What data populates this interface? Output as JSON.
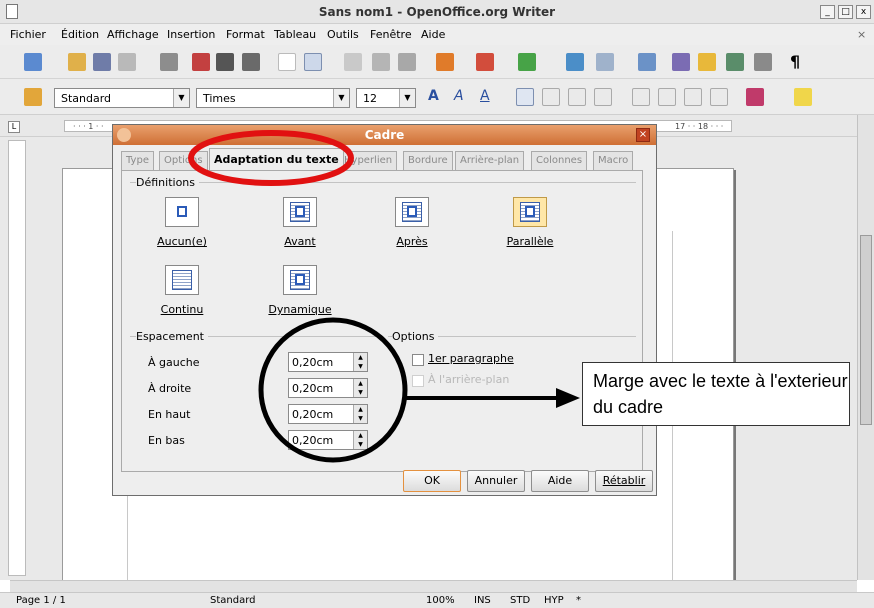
{
  "window": {
    "title": "Sans nom1 - OpenOffice.org Writer",
    "buttons": [
      "_",
      "□",
      "x"
    ],
    "close_doc": "×"
  },
  "menu": [
    "Fichier",
    "Édition",
    "Affichage",
    "Insertion",
    "Format",
    "Tableau",
    "Outils",
    "Fenêtre",
    "Aide"
  ],
  "formatting": {
    "style": "Standard",
    "font": "Times",
    "size": "12"
  },
  "ruler": {
    "marks": "· · · 1 · ·",
    "right": "17 · · 18 · · ·"
  },
  "dialog": {
    "title": "Cadre",
    "tabs": [
      "Type",
      "Options",
      "Adaptation du texte",
      "Hyperlien",
      "Bordure",
      "Arrière-plan",
      "Colonnes",
      "Macro"
    ],
    "definitions_label": "Définitions",
    "wrap_options": [
      "Aucun(e)",
      "Avant",
      "Après",
      "Parallèle",
      "Continu",
      "Dynamique"
    ],
    "spacing_label": "Espacement",
    "spacing": [
      {
        "label": "À gauche",
        "value": "0,20cm"
      },
      {
        "label": "À droite",
        "value": "0,20cm"
      },
      {
        "label": "En haut",
        "value": "0,20cm"
      },
      {
        "label": "En bas",
        "value": "0,20cm"
      }
    ],
    "options_label": "Options",
    "option_first": "1er paragraphe",
    "option_background": "À l'arrière-plan",
    "buttons": {
      "ok": "OK",
      "cancel": "Annuler",
      "help": "Aide",
      "reset": "Rétablir"
    }
  },
  "annotation": {
    "text": "Marge avec le texte à l'exterieur du cadre"
  },
  "status": {
    "page": "Page 1 / 1",
    "style": "Standard",
    "zoom": "100%",
    "ins": "INS",
    "std": "STD",
    "hyp": "HYP",
    "star": "*"
  },
  "colors": {
    "dialog_title": "#d9773d",
    "highlight_red": "#e11111",
    "annotation_black": "#000000"
  }
}
